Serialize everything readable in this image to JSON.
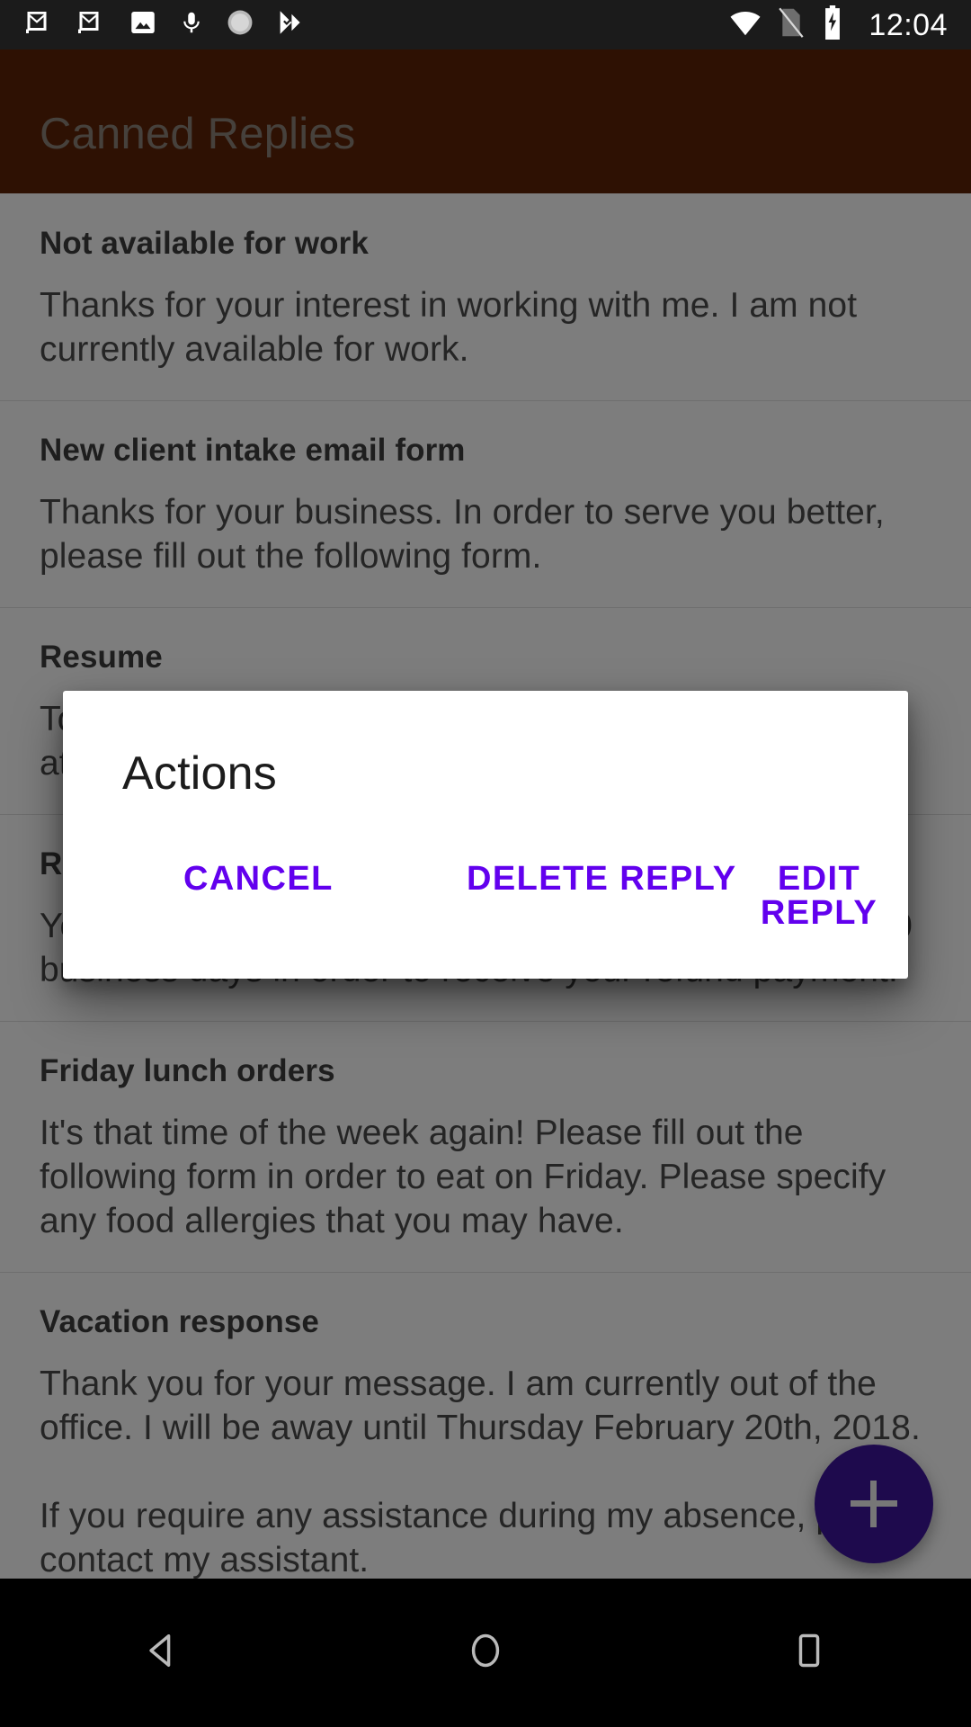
{
  "statusbar": {
    "icons": [
      "gmail-icon",
      "gmail-icon",
      "photos-icon",
      "microphone-icon",
      "sync-spinner-icon",
      "tasks-check-icon"
    ],
    "right_icons": [
      "wifi-icon",
      "no-sim-icon",
      "battery-charging-icon"
    ],
    "clock": "12:04"
  },
  "appbar": {
    "title": "Canned Replies",
    "color": "#5c2207"
  },
  "list": {
    "items": [
      {
        "title": "Not available for work",
        "body": "Thanks for your interest in working with me. I am not currently available for work."
      },
      {
        "title": "New client intake email form",
        "body": "Thanks for your business. In order to serve you better, please fill out the following form."
      },
      {
        "title": "Resume",
        "body": "To whom it may concern, please find my resume attached."
      },
      {
        "title": "Refund policy",
        "body": "Your refund request has been received. Please allow 10 business days in order to receive your refund payment."
      },
      {
        "title": "Friday lunch orders",
        "body": "It's that time of the week again! Please fill out the following form in order to eat on Friday. Please specify any food allergies that you may have."
      },
      {
        "title": "Vacation response",
        "body": "Thank you for your message. I am currently out of the office. I will be away until Thursday February 20th, 2018.\n\nIf you require any assistance during my absence, please contact my assistant."
      }
    ]
  },
  "fab": {
    "label": "+",
    "icon": "plus-icon",
    "color": "#3d159b"
  },
  "dialog": {
    "title": "Actions",
    "cancel_label": "CANCEL",
    "delete_label": "DELETE REPLY",
    "edit_label": "EDIT REPLY",
    "accent_color": "#6200ee"
  },
  "navbar": {
    "back": "back-icon",
    "home": "home-icon",
    "recents": "recents-icon"
  }
}
